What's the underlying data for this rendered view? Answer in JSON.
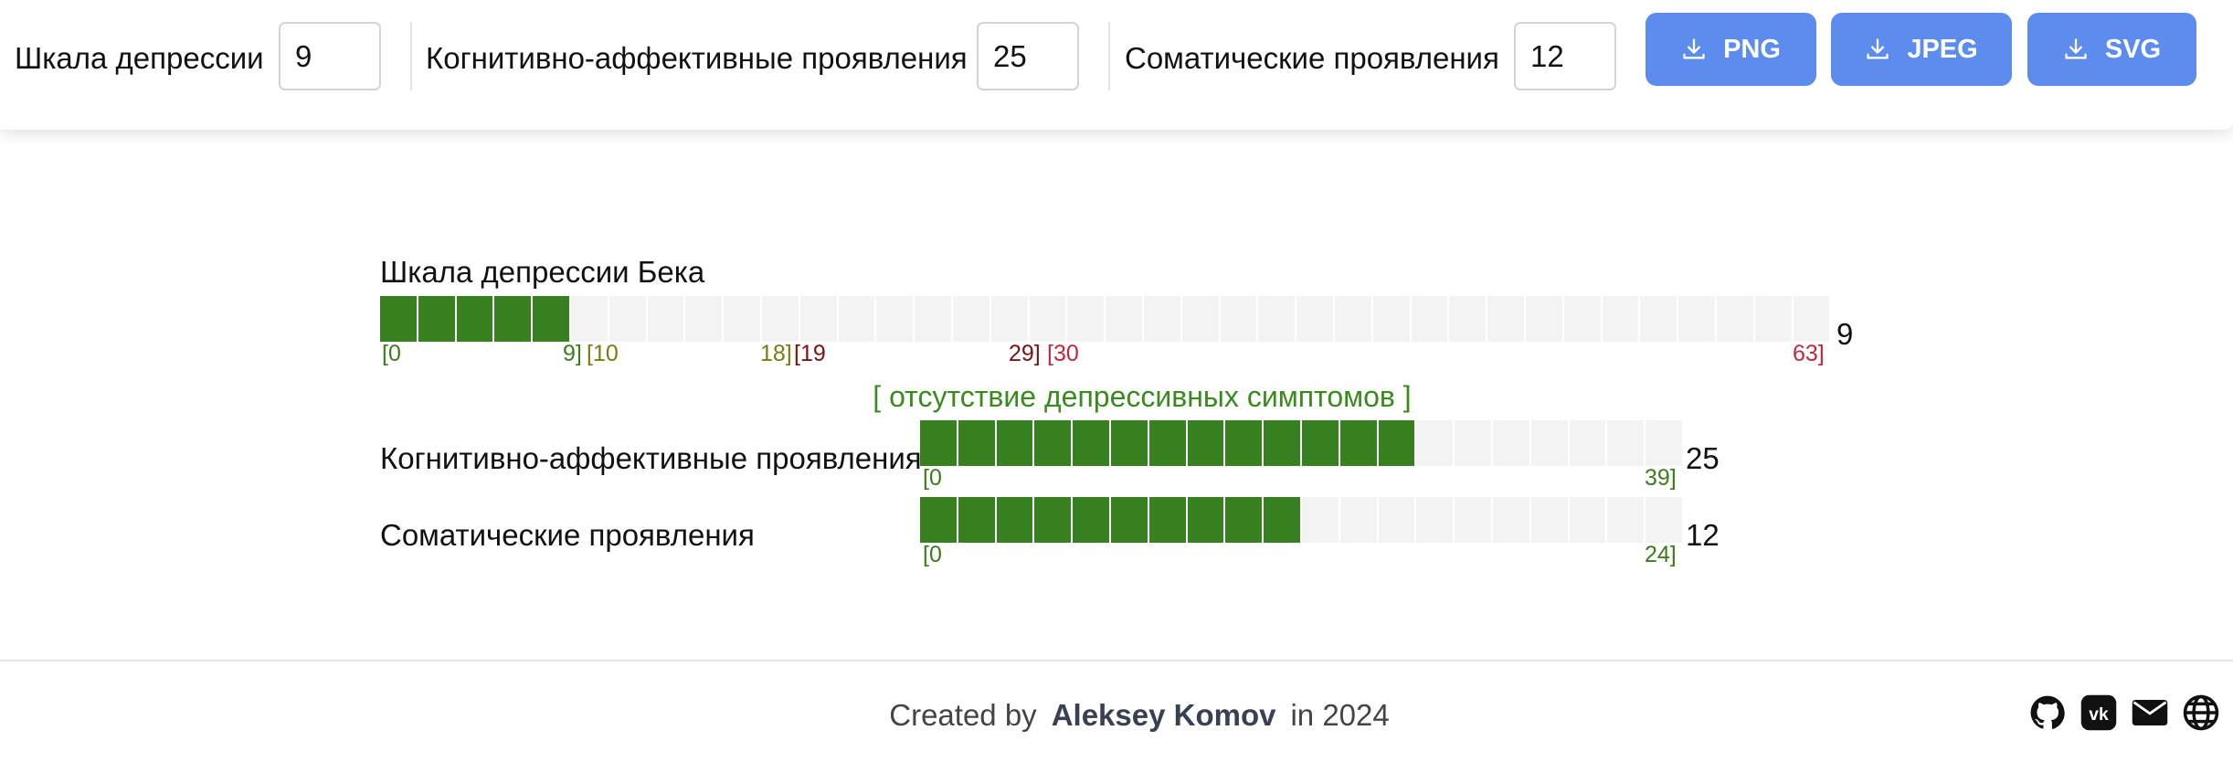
{
  "toolbar": {
    "fields": [
      {
        "label": "Шкала депрессии",
        "value": "9"
      },
      {
        "label": "Когнитивно-аффективные проявления",
        "value": "25"
      },
      {
        "label": "Соматические проявления",
        "value": "12"
      }
    ],
    "buttons": [
      {
        "label": "PNG",
        "icon": "download-icon"
      },
      {
        "label": "JPEG",
        "icon": "download-icon"
      },
      {
        "label": "SVG",
        "icon": "download-icon"
      }
    ],
    "button_color": "#5b8cee"
  },
  "chart_data": {
    "type": "bar",
    "title": "Шкала депрессии Бека",
    "main": {
      "value": 9,
      "value_label": "9",
      "max": 63,
      "filled_cells": 5,
      "total_cells": 38,
      "ranges": [
        {
          "start": "[0",
          "end": "9]",
          "color": "#3b7d1a"
        },
        {
          "start": "[10",
          "end": "18]",
          "color": "#7a7a12"
        },
        {
          "start": "[19",
          "end": "29]",
          "color": "#7a1212"
        },
        {
          "start": "[30",
          "end": "63]",
          "color": "#c0283c"
        }
      ],
      "verdict": "[ отсутствие депрессивных симптомов ]"
    },
    "subscales": [
      {
        "label": "Когнитивно-аффективные проявления",
        "value": 25,
        "value_label": "25",
        "min_label": "[0",
        "max_label": "39]",
        "filled_cells": 13,
        "total_cells": 20
      },
      {
        "label": "Соматические проявления",
        "value": 12,
        "value_label": "12",
        "min_label": "[0",
        "max_label": "24]",
        "filled_cells": 10,
        "total_cells": 20
      }
    ],
    "fill_color": "#37801f",
    "empty_color": "#f3f3f3"
  },
  "footer": {
    "pre": "Created by",
    "author": "Aleksey Komov",
    "post": "in 2024",
    "links": [
      "github-icon",
      "vk-icon",
      "mail-icon",
      "globe-icon"
    ]
  }
}
